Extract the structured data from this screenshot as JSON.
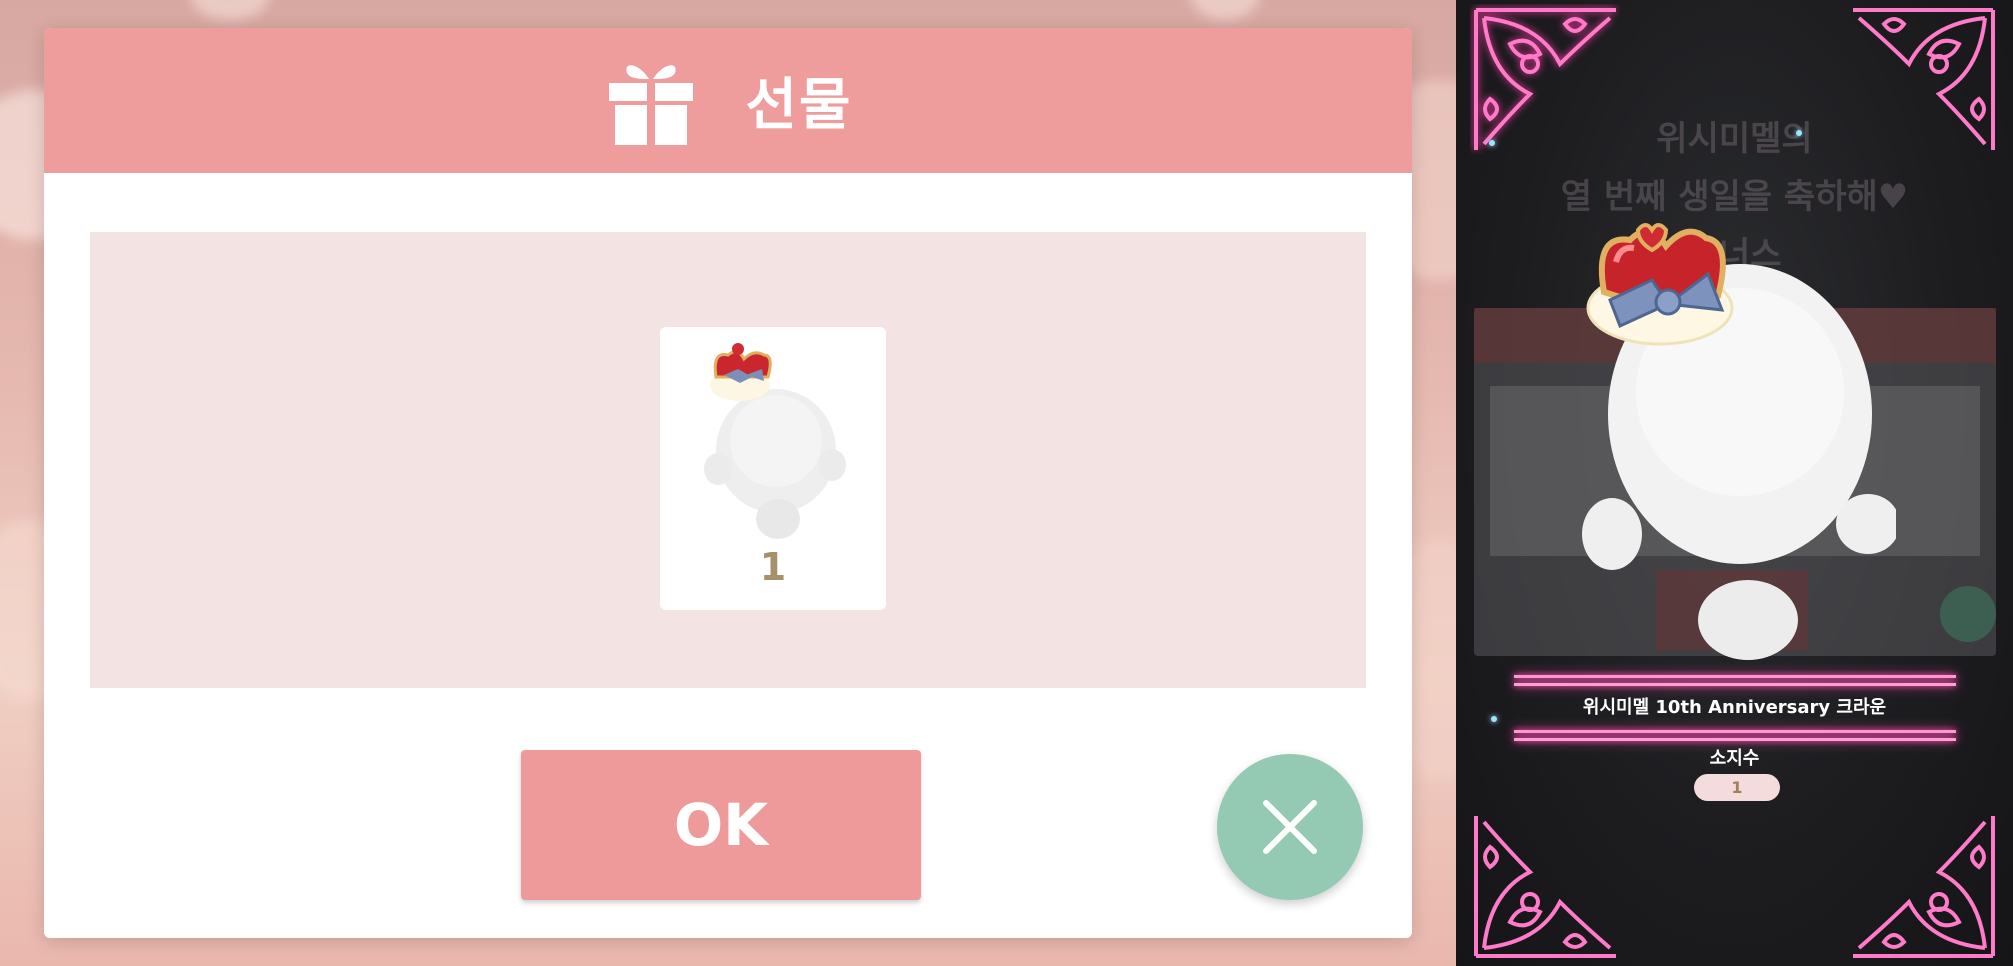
{
  "gift_dialog": {
    "title": "선물",
    "icon": "gift-icon",
    "reward": {
      "item_icon": "crown-hat-icon",
      "quantity": "1"
    },
    "ok_label": "OK",
    "close_icon": "close-icon"
  },
  "preview": {
    "background_banner": [
      "위시미멜의",
      "열 번째 생일을 축하해♥",
      "보너스"
    ],
    "item_name": "위시미멜 10th Anniversary 크라운",
    "owned_label": "소지수",
    "owned_count": "1"
  },
  "colors": {
    "header": "#ef9c9c",
    "panel": "#f3e3e3",
    "ok_button": "#ef9a9a",
    "close_button": "#94c9b3",
    "neon": "#ff4fb0",
    "quantity_text": "#a6916b"
  }
}
